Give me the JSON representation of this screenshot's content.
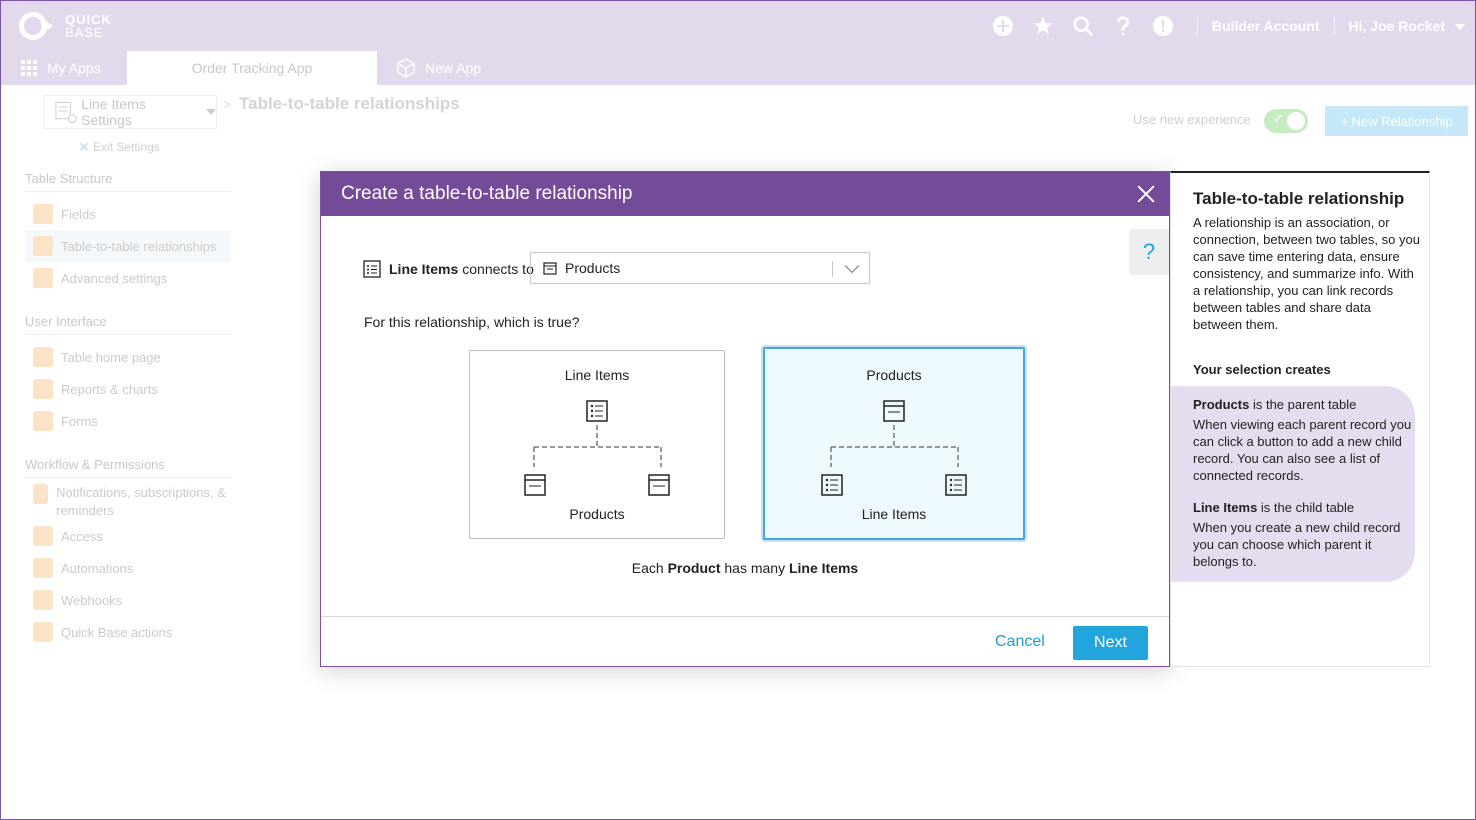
{
  "brand": {
    "line1": "QUICK",
    "line2": "BASE"
  },
  "topbar": {
    "account": "Builder Account",
    "user": "Hi, Joe Rocket"
  },
  "tabs": {
    "my_apps": "My Apps",
    "order_tracking": "Order Tracking App",
    "new_app": "New App"
  },
  "header": {
    "settings_label": "Line Items Settings",
    "exit_label": "Exit Settings",
    "breadcrumb_sep": ">",
    "title": "Table-to-table relationships",
    "use_new_label": "Use new experience",
    "new_relationship_label": "+ New Relationship"
  },
  "sidebar": {
    "groups": [
      {
        "title": "Table Structure",
        "items": [
          "Fields",
          "Table-to-table relationships",
          "Advanced settings"
        ]
      },
      {
        "title": "User Interface",
        "items": [
          "Table home page",
          "Reports & charts",
          "Forms"
        ]
      },
      {
        "title": "Workflow & Permissions",
        "items": [
          "Notifications, subscriptions, & reminders",
          "Access",
          "Automations",
          "Webhooks",
          "Quick Base actions"
        ]
      }
    ]
  },
  "modal": {
    "title": "Create a table-to-table relationship",
    "help_symbol": "?",
    "source_table": "Line Items",
    "connects_label": "connects to",
    "target_table": "Products",
    "question": "For this relationship, which is true?",
    "option_a": {
      "top": "Line Items",
      "bottom": "Products"
    },
    "option_b": {
      "top": "Products",
      "bottom": "Line Items"
    },
    "summary": {
      "pre": "Each",
      "parent": "Product",
      "mid": "has many",
      "child": "Line Items"
    },
    "cancel_label": "Cancel",
    "next_label": "Next"
  },
  "panel": {
    "title": "Table-to-table relationship",
    "description": "A relationship is an association, or connection, between two tables, so you can save time entering data, ensure consistency, and summarize info. With a relationship, you can link records between tables and share data between them.",
    "selection_title": "Your selection creates",
    "parent_name": "Products",
    "parent_suffix": "is the parent table",
    "parent_desc": "When viewing each parent record you can click a button to add a new child record. You can also see a list of connected records.",
    "child_name": "Line Items",
    "child_suffix": "is the child table",
    "child_desc": "When you create a new child record you can choose which parent it belongs to."
  },
  "colors": {
    "brand_purple": "#744b99",
    "accent_blue": "#22a5dd",
    "topbar": "#e3d9ec"
  }
}
